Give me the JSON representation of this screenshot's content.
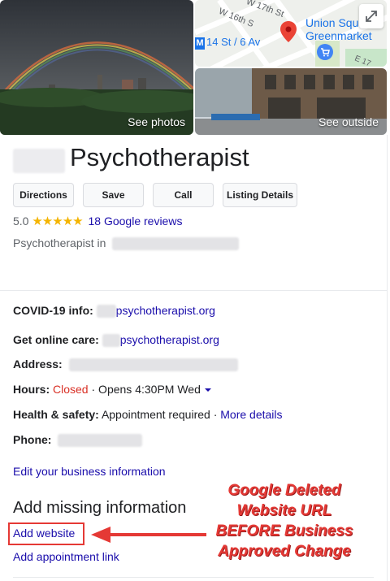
{
  "photos": {
    "main_label": "See photos",
    "outside_label": "See outside"
  },
  "map": {
    "streets": [
      "W 17th St",
      "W 16th S",
      "E 17"
    ],
    "station_label": "14 St / 6 Av",
    "station_badge": "M",
    "place_label_1": "Union Squ",
    "place_label_2": "Greenmarket"
  },
  "business": {
    "title": "Psychotherapist",
    "category_prefix": "Psychotherapist in"
  },
  "actions": {
    "directions": "Directions",
    "save": "Save",
    "call": "Call",
    "listing": "Listing Details"
  },
  "rating": {
    "value": "5.0",
    "stars": "★★★★★",
    "reviews": "18 Google reviews"
  },
  "info": {
    "covid_label": "COVID-19 info:",
    "covid_link": "psychotherapist.org",
    "online_label": "Get online care:",
    "online_link": "psychotherapist.org",
    "address_label": "Address:",
    "hours_label": "Hours:",
    "hours_status": "Closed",
    "hours_rest": "· Opens 4:30PM Wed",
    "health_label": "Health & safety:",
    "health_value": "Appointment required ·",
    "health_link": "More details",
    "phone_label": "Phone:"
  },
  "edit_link": "Edit your business information",
  "missing": {
    "heading": "Add missing information",
    "add_website": "Add website",
    "add_appointment": "Add appointment link"
  },
  "annotation": {
    "line1": "Google Deleted",
    "line2": "Website URL",
    "line3": "BEFORE Business",
    "line4": "Approved Change"
  },
  "colors": {
    "link": "#1a0dab",
    "closed": "#d93025",
    "star": "#f4b400",
    "annotation": "#e53935"
  }
}
